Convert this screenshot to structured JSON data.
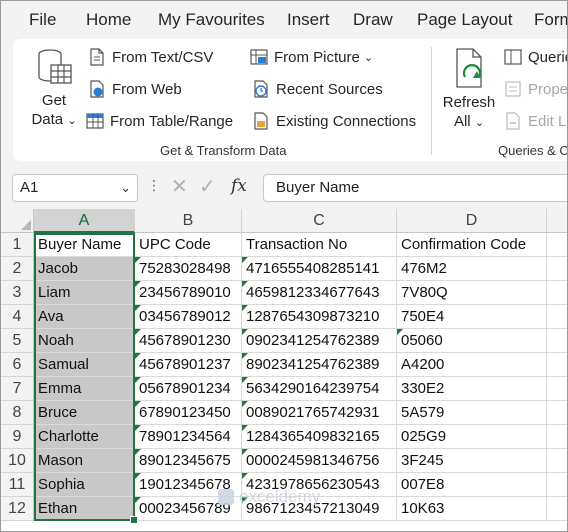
{
  "menu": [
    "File",
    "Home",
    "My Favourites",
    "Insert",
    "Draw",
    "Page Layout",
    "Form"
  ],
  "ribbon": {
    "get_data": {
      "line1": "Get",
      "line2": "Data",
      "icon": "database-table-icon"
    },
    "from_text_csv": "From Text/CSV",
    "from_web": "From Web",
    "from_table_range": "From Table/Range",
    "from_picture": "From Picture",
    "recent_sources": "Recent Sources",
    "existing_connections": "Existing Connections",
    "group_get_transform": "Get & Transform Data",
    "refresh": {
      "line1": "Refresh",
      "line2": "All"
    },
    "queries": "Querie",
    "properties": "Prope",
    "edit_links": "Edit Li",
    "group_queries": "Queries & C"
  },
  "formula_bar": {
    "name_box": "A1",
    "fx": "fx",
    "content": "Buyer Name"
  },
  "grid": {
    "columns": [
      "A",
      "B",
      "C",
      "D"
    ],
    "rows": [
      [
        "Buyer Name",
        "UPC Code",
        "Transaction No",
        "Confirmation Code"
      ],
      [
        "Jacob",
        "75283028498",
        "4716555408285141",
        "476M2"
      ],
      [
        "Liam",
        "23456789010",
        "4659812334677643",
        "7V80Q"
      ],
      [
        "Ava",
        "03456789012",
        "1287654309873210",
        "750E4"
      ],
      [
        "Noah",
        "45678901230",
        "0902341254762389",
        "05060"
      ],
      [
        "Samual",
        "45678901237",
        "8902341254762389",
        "A4200"
      ],
      [
        "Emma",
        "05678901234",
        "5634290164239754",
        "330E2"
      ],
      [
        "Bruce",
        "67890123450",
        "0089021765742931",
        "5A579"
      ],
      [
        "Charlotte",
        "78901234564",
        "1284365409832165",
        "025G9"
      ],
      [
        "Mason",
        "89012345675",
        "0000245981346756",
        "3F245"
      ],
      [
        "Sophia",
        "19012345678",
        "4231978656230543",
        "007E8"
      ],
      [
        "Ethan",
        "00023456789",
        "9867123457213049",
        "10K63"
      ]
    ]
  },
  "watermark": "exceldemy"
}
